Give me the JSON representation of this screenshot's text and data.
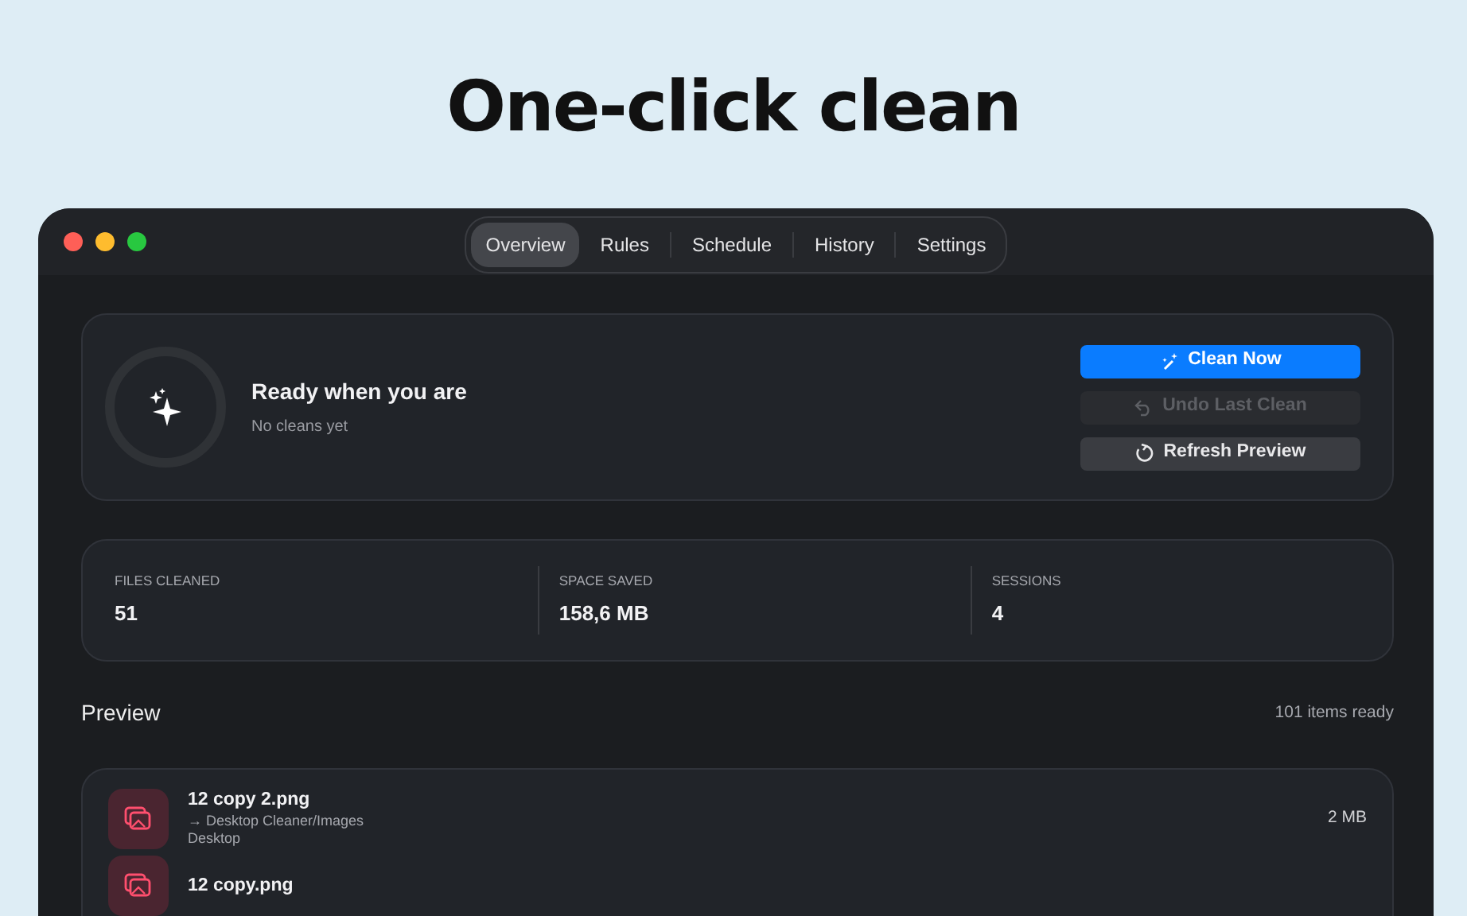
{
  "headline": "One-click clean",
  "window": {
    "traffic_lights": [
      {
        "color": "#fe5f57"
      },
      {
        "color": "#febc2e"
      },
      {
        "color": "#28c840"
      }
    ]
  },
  "tabs": [
    {
      "label": "Overview",
      "selected": true
    },
    {
      "label": "Rules",
      "selected": false
    },
    {
      "label": "Schedule",
      "selected": false
    },
    {
      "label": "History",
      "selected": false
    },
    {
      "label": "Settings",
      "selected": false
    }
  ],
  "status": {
    "title": "Ready when you are",
    "subtitle": "No cleans yet"
  },
  "buttons": [
    {
      "label": "Clean Now",
      "kind": "primary",
      "disabled": false
    },
    {
      "label": "Undo Last Clean",
      "kind": "secondary",
      "disabled": true
    },
    {
      "label": "Refresh Preview",
      "kind": "secondary",
      "disabled": false
    }
  ],
  "stats": [
    {
      "label": "FILES CLEANED",
      "value": "51"
    },
    {
      "label": "SPACE SAVED",
      "value": "158,6 MB"
    },
    {
      "label": "SESSIONS",
      "value": "4"
    }
  ],
  "preview": {
    "title": "Preview",
    "count": "101 items ready",
    "items": [
      {
        "name": "12 copy 2.png",
        "destination": "→ Desktop Cleaner/Images",
        "source": "Desktop",
        "size": "2 MB"
      },
      {
        "name": "12 copy.png"
      }
    ]
  }
}
